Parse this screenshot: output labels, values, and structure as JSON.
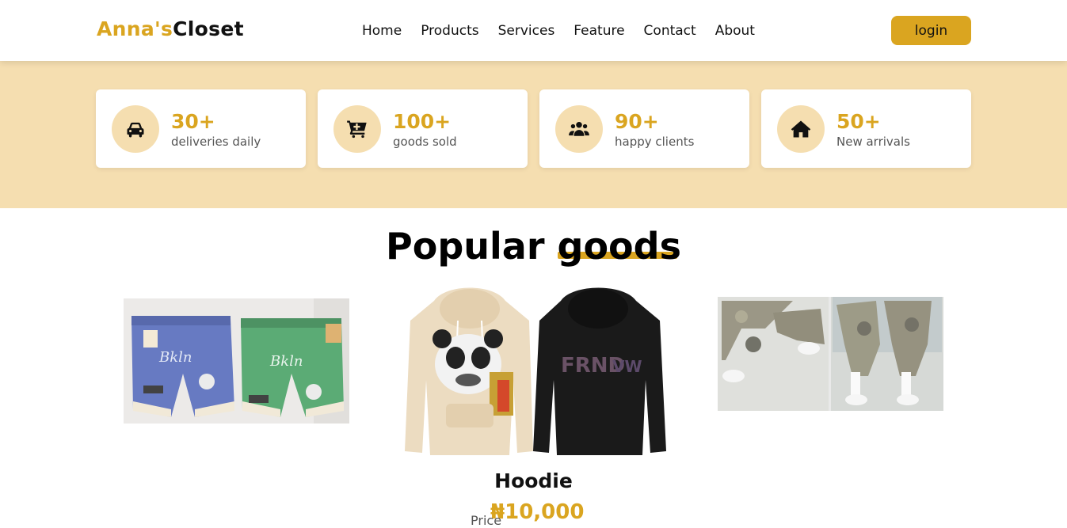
{
  "brand": {
    "part1": "Anna's",
    "part2": "Closet"
  },
  "nav": {
    "items": [
      "Home",
      "Products",
      "Services",
      "Feature",
      "Contact",
      "About"
    ]
  },
  "header": {
    "login_label": "login"
  },
  "stats": [
    {
      "icon": "car-icon",
      "number": "30+",
      "label": "deliveries daily"
    },
    {
      "icon": "cart-plus-icon",
      "number": "100+",
      "label": "goods sold"
    },
    {
      "icon": "users-icon",
      "number": "90+",
      "label": "happy clients"
    },
    {
      "icon": "home-icon",
      "number": "50+",
      "label": "New arrivals"
    }
  ],
  "popular": {
    "title": "Popular goods",
    "products": [
      {
        "image": "shorts-image"
      },
      {
        "image": "hoodie-image",
        "name": "Hoodie",
        "price_label": "Price",
        "price": "₦10,000"
      },
      {
        "image": "camo-pants-image"
      }
    ]
  },
  "colors": {
    "accent": "#daa520",
    "band": "#f5deb0",
    "text": "#111111"
  }
}
